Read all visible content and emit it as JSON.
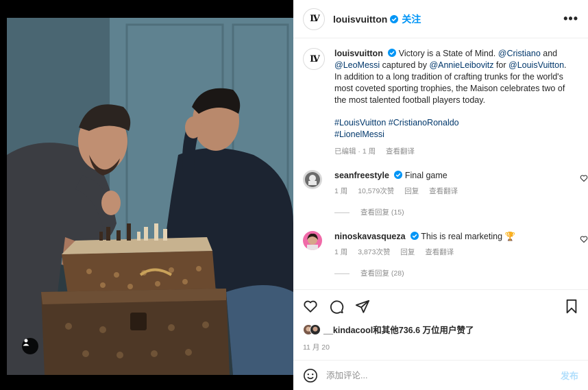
{
  "post": {
    "username": "louisvuitton",
    "follow_label": "关注",
    "more_label": "•••",
    "logo_text": "LV"
  },
  "caption": {
    "username": "louisvuitton",
    "text_1": " Victory is a State of Mind. ",
    "mention_cristiano": "@Cristiano",
    "text_2": " and ",
    "mention_leo": "@LeoMessi",
    "text_3": " captured by ",
    "mention_annie": "@AnnieLeibovitz",
    "text_4": " for ",
    "mention_lv": "@LouisVuitton",
    "text_5": ". In addition to a long tradition of crafting trunks for the world's most coveted sporting trophies, the Maison celebrates two of the most talented football players today.",
    "hashtags": [
      "#LouisVuitton",
      "#CristianoRonaldo",
      "#LionelMessi"
    ],
    "edited": "已编辑 · 1 周",
    "translate": "查看翻译"
  },
  "comments": [
    {
      "username": "seanfreestyle",
      "text": "Final game",
      "time": "1 周",
      "likes": "10,579次赞",
      "reply": "回复",
      "translate": "查看翻译",
      "view_replies": "查看回复 (15)"
    },
    {
      "username": "ninoskavasqueza",
      "text": "This is real marketing 🏆",
      "time": "1 周",
      "likes": "3,873次赞",
      "reply": "回复",
      "translate": "查看翻译",
      "view_replies": "查看回复 (28)"
    }
  ],
  "likes": {
    "user": "__kindacool",
    "text": "和其他736.6 万位用户赞了"
  },
  "date": "11 月 20",
  "composer": {
    "placeholder": "添加评论...",
    "post_label": "发布"
  },
  "colors": {
    "accent": "#0095f6",
    "verified": "#0095f6",
    "link": "#00376b",
    "muted": "#8e8e8e"
  }
}
